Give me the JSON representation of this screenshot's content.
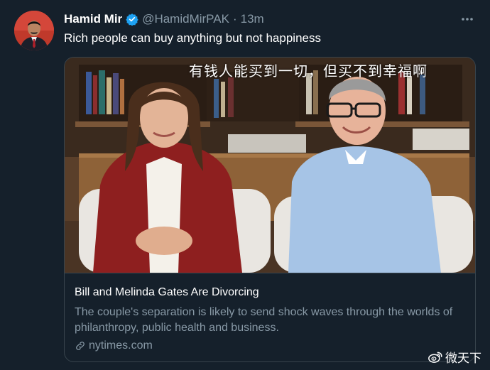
{
  "tweet": {
    "author_name": "Hamid Mir",
    "handle": "@HamidMirPAK",
    "separator": "·",
    "time": "13m",
    "text": "Rich people can buy anything but not happiness"
  },
  "card": {
    "overlay_caption": "有钱人能买到一切，但买不到幸福啊",
    "title": "Bill and Melinda Gates Are Divorcing",
    "description": "The couple's separation is likely to send shock waves through the worlds of philanthropy, public health and business.",
    "domain": "nytimes.com"
  },
  "watermark": {
    "text": "微天下"
  },
  "icons": {
    "verified": "verified-badge-icon",
    "more": "more-options-icon",
    "link": "link-icon",
    "weibo": "weibo-logo-icon"
  },
  "colors": {
    "background": "#15202b",
    "secondary_text": "#8899a6",
    "border": "#38444d",
    "verified_blue": "#1da1f2"
  }
}
